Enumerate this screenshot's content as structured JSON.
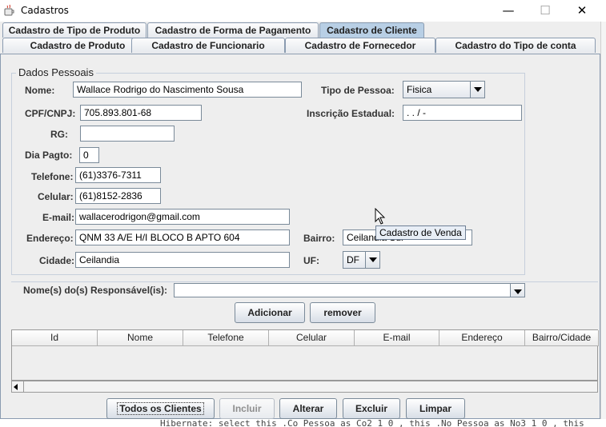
{
  "window": {
    "title": "Cadastros",
    "minimize_glyph": "—",
    "maximize_glyph": "☐",
    "close_glyph": "✕"
  },
  "tabs_row1": [
    {
      "label": "Cadastro de Tipo de Produto"
    },
    {
      "label": "Cadastro de Forma de Pagamento"
    },
    {
      "label": "Cadastro de Cliente",
      "selected": true
    }
  ],
  "tabs_row2": [
    {
      "label": "Cadastro de Produto"
    },
    {
      "label": "Cadastro de Funcionario"
    },
    {
      "label": "Cadastro de Fornecedor"
    },
    {
      "label": "Cadastro do Tipo de conta"
    }
  ],
  "form": {
    "group_title": "Dados Pessoais",
    "nome_label": "Nome:",
    "nome_value": "Wallace Rodrigo do Nascimento Sousa",
    "tipo_pessoa_label": "Tipo de Pessoa:",
    "tipo_pessoa_value": "Fisica",
    "cpf_label": "CPF/CNPJ:",
    "cpf_value": "705.893.801-68",
    "inscricao_label": "Inscrição Estadual:",
    "inscricao_value": " .  .  /  -",
    "rg_label": "RG:",
    "rg_value": "",
    "dia_pagto_label": "Dia Pagto:",
    "dia_pagto_value": "0",
    "telefone_label": "Telefone:",
    "telefone_value": "(61)3376-7311",
    "celular_label": "Celular:",
    "celular_value": "(61)8152-2836",
    "email_label": "E-mail:",
    "email_value": "wallacerodrigon@gmail.com",
    "endereco_label": "Endereço:",
    "endereco_value": "QNM 33 A/E H/I BLOCO B APTO 604",
    "bairro_label": "Bairro:",
    "bairro_value": "Ceilandia Sul",
    "cidade_label": "Cidade:",
    "cidade_value": "Ceilandia",
    "uf_label": "UF:",
    "uf_value": "DF"
  },
  "responsaveis": {
    "label": "Nome(s) do(s) Responsável(is):",
    "value": "",
    "add_button": "Adicionar",
    "remove_button": "remover"
  },
  "table": {
    "columns": [
      "Id",
      "Nome",
      "Telefone",
      "Celular",
      "E-mail",
      "Endereço",
      "Bairro/Cidade"
    ],
    "rows": []
  },
  "tooltip": "Cadastro de Venda",
  "buttons": {
    "todos": "Todos os Clientes",
    "incluir": "Incluir",
    "alterar": "Alterar",
    "excluir": "Excluir",
    "limpar": "Limpar"
  },
  "console_text": "Hibernate: select this_.Co_Pessoa as Co2_1_0_, this_.No_Pessoa as No3_1_0_, this_",
  "colors": {
    "selected_tab": "#b8cfe5",
    "window_bg": "#eeeeee",
    "border": "#8a9bb0"
  },
  "icons": {
    "app": "java-cup-icon",
    "combo_arrow": "chevron-down-icon",
    "scroll_left": "arrow-left-icon"
  }
}
